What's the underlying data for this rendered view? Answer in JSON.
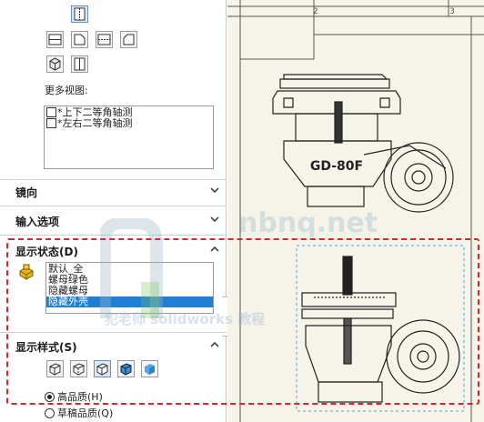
{
  "panel": {
    "more_views_label": "更多视图:",
    "more_views": [
      {
        "label": "*上下二等角轴测",
        "checked": false
      },
      {
        "label": "*左右二等角轴测",
        "checked": false
      }
    ],
    "sections": {
      "mirror": "镜向",
      "input_options": "输入选项",
      "display_state": "显示状态(D)",
      "display_style": "显示样式(S)"
    },
    "display_states": [
      {
        "label": "默认_全",
        "selected": false
      },
      {
        "label": "螺母绿色",
        "selected": false
      },
      {
        "label": "隐藏螺母",
        "selected": false
      },
      {
        "label": "隐藏外壳",
        "selected": true
      }
    ],
    "quality": [
      {
        "label": "高品质(H)",
        "selected": true
      },
      {
        "label": "草稿品质(Q)",
        "selected": false
      }
    ]
  },
  "drawing": {
    "zone_numbers": [
      "2",
      "3"
    ],
    "part_label": "GD-80F"
  },
  "watermark": {
    "logo_text": "nbnq.net",
    "caption": "犯老师 solidworks 教程"
  },
  "colors": {
    "highlight": "#e0222a",
    "selection": "#1f7fd6",
    "canvas": "#f6f4e9"
  }
}
